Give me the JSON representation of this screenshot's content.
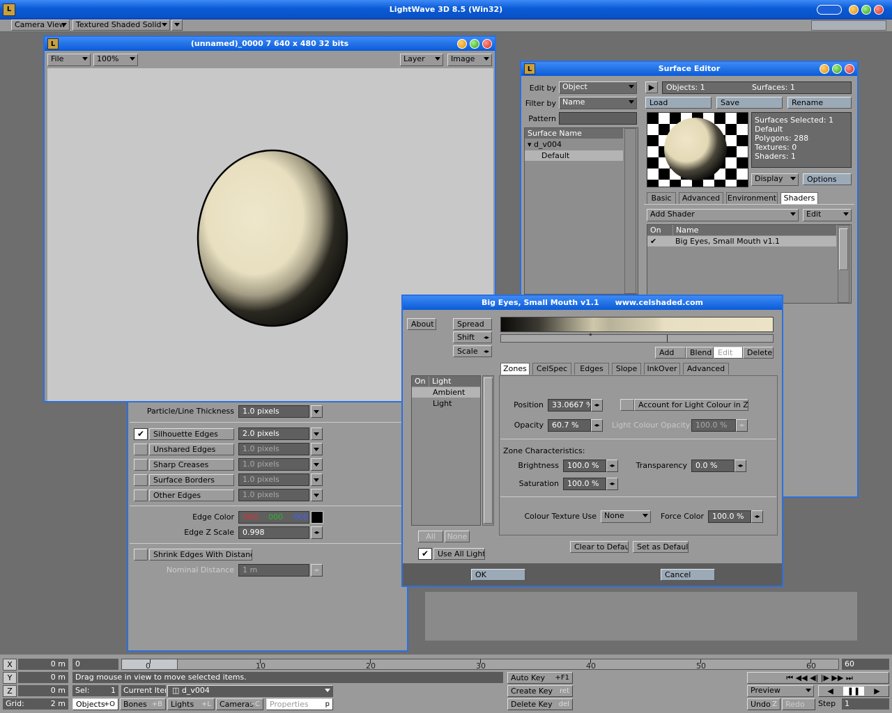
{
  "app": {
    "title": "LightWave 3D 8.5 (Win32)",
    "camera_view": "Camera View",
    "render_mode": "Textured Shaded Solid"
  },
  "render_window": {
    "title": "(unnamed)_0000 7  640 x 480 32 bits",
    "file_menu": "File",
    "zoom": "100%",
    "layer_menu": "Layer",
    "image_menu": "Image"
  },
  "edge_panel": {
    "particle_label": "Particle/Line Thickness",
    "particle_value": "1.0 pixels",
    "edges": [
      {
        "label": "Silhouette Edges",
        "value": "2.0 pixels",
        "checked": true
      },
      {
        "label": "Unshared Edges",
        "value": "1.0 pixels",
        "checked": false
      },
      {
        "label": "Sharp Creases",
        "value": "1.0 pixels",
        "checked": false
      },
      {
        "label": "Surface Borders",
        "value": "1.0 pixels",
        "checked": false
      },
      {
        "label": "Other Edges",
        "value": "1.0 pixels",
        "checked": false
      }
    ],
    "edge_color_label": "Edge Color",
    "edge_color_r": "000",
    "edge_color_g": "000",
    "edge_color_b": "000",
    "edge_z_label": "Edge Z Scale",
    "edge_z_value": "0.998",
    "shrink_label": "Shrink Edges With Distance",
    "nominal_label": "Nominal Distance",
    "nominal_value": "1 m"
  },
  "surface_editor": {
    "title": "Surface Editor",
    "edit_by_label": "Edit by",
    "edit_by_value": "Object",
    "filter_by_label": "Filter by",
    "filter_by_value": "Name",
    "pattern_label": "Pattern",
    "list_header": "Surface Name",
    "object_name": "d_v004",
    "surface_name": "Default",
    "objects_count": "Objects: 1",
    "surfaces_count": "Surfaces: 1",
    "load": "Load",
    "save": "Save",
    "rename": "Rename",
    "info": [
      "Surfaces Selected: 1",
      "Default",
      "Polygons: 288",
      "Textures: 0",
      "Shaders: 1"
    ],
    "display": "Display",
    "options": "Options",
    "tabs": [
      "Basic",
      "Advanced",
      "Environment",
      "Shaders"
    ],
    "add_shader": "Add Shader",
    "edit": "Edit",
    "col_on": "On",
    "col_name": "Name",
    "shader_name": "Big Eyes, Small Mouth v1.1"
  },
  "bესm": {
    "title": "Big Eyes, Small Mouth v1.1      www.celshaded.com",
    "about": "About",
    "spread": "Spread",
    "shift": "Shift",
    "scale": "Scale",
    "add": "Add",
    "blend": "Blend",
    "edit": "Edit",
    "delete": "Delete",
    "tabs": [
      "Zones",
      "CelSpec",
      "Edges",
      "Slope",
      "InkOver",
      "Advanced"
    ],
    "light_col_on": "On",
    "light_col_name": "Light",
    "lights": [
      "Ambient",
      "Light"
    ],
    "all": "All",
    "none": "None",
    "use_all_lights": "Use All Lights",
    "position_label": "Position",
    "position_value": "33.0667 %",
    "account_label": "Account for Light Colour in Zone",
    "opacity_label": "Opacity",
    "opacity_value": "60.7 %",
    "light_opacity_label": "Light Colour Opacity",
    "light_opacity_value": "100.0 %",
    "zone_char": "Zone Characteristics:",
    "brightness_label": "Brightness",
    "brightness_value": "100.0 %",
    "transparency_label": "Transparency",
    "transparency_value": "0.0 %",
    "saturation_label": "Saturation",
    "saturation_value": "100.0 %",
    "colour_texture_label": "Colour Texture Use",
    "colour_texture_value": "None",
    "force_color_label": "Force Color",
    "force_color_value": "100.0 %",
    "clear_default": "Clear to Default",
    "set_default": "Set as Default",
    "ok": "OK",
    "cancel": "Cancel"
  },
  "bottom": {
    "x_label": "X",
    "y_label": "Y",
    "z_label": "Z",
    "x_val": "0 m",
    "y_val": "0 m",
    "z_val": "0 m",
    "grid_label": "Grid:",
    "grid_val": "2 m",
    "frame_start": "0",
    "frame_end": "60",
    "ticks": [
      "0",
      "10",
      "20",
      "30",
      "40",
      "50",
      "60"
    ],
    "status": "Drag mouse in view to move selected items.",
    "sel_label": "Sel:",
    "sel_val": "1",
    "current_item_label": "Current Item",
    "current_item": "d_v004",
    "objects": "Objects",
    "objects_key": "+O",
    "bones": "Bones",
    "bones_key": "+B",
    "lights": "Lights",
    "lights_key": "+L",
    "cameras": "Cameras",
    "cameras_key": "+C",
    "properties": "Properties",
    "properties_key": "p",
    "auto_key": "Auto Key",
    "auto_key_hint": "+F1",
    "create_key": "Create Key",
    "create_key_hint": "ret",
    "delete_key": "Delete Key",
    "delete_key_hint": "del",
    "preview": "Preview",
    "undo": "Undo",
    "undo_key": "Z",
    "redo": "Redo",
    "step_label": "Step",
    "step_val": "1"
  }
}
